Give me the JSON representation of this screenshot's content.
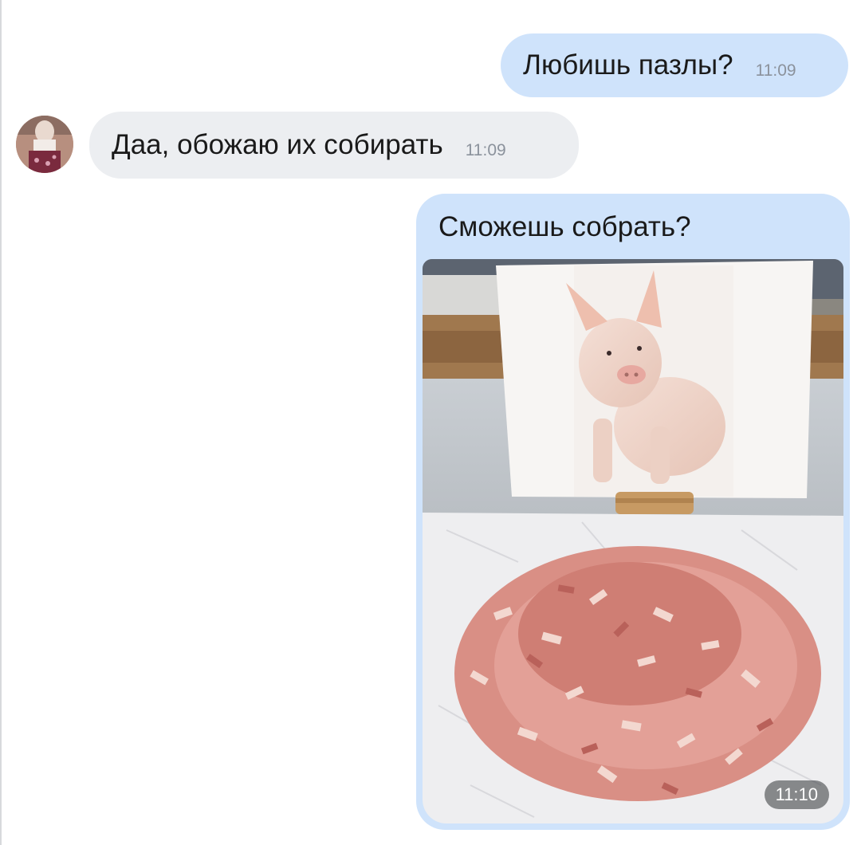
{
  "conversation": {
    "messages": [
      {
        "direction": "outgoing",
        "text": "Любишь пазлы?",
        "time": "11:09"
      },
      {
        "direction": "incoming",
        "text": "Даа, обожаю их собирать",
        "time": "11:09"
      },
      {
        "direction": "outgoing",
        "text": "Сможешь собрать?",
        "time": "11:10",
        "attachment": "photo"
      }
    ]
  },
  "colors": {
    "outgoing_bubble": "#cfe3fb",
    "incoming_bubble": "#eceef1",
    "timestamp": "#8b929c"
  }
}
